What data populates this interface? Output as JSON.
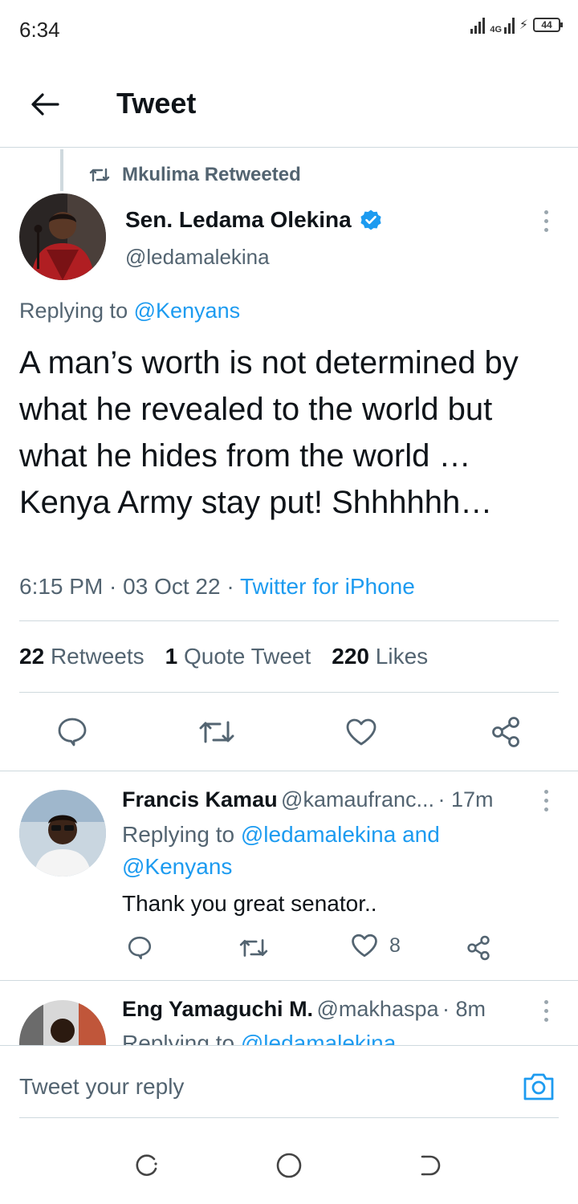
{
  "status_bar": {
    "time": "6:34",
    "network": "4G",
    "battery": "44"
  },
  "header": {
    "title": "Tweet"
  },
  "retweet_context": {
    "label": "Mkulima Retweeted"
  },
  "tweet": {
    "author_name": "Sen. Ledama Olekina",
    "author_handle": "@ledamalekina",
    "replying_prefix": "Replying to",
    "replying_to": "@Kenyans",
    "text": "A man’s worth is not determined by what he revealed to the world but what he hides from the world … Kenya Army stay put! Shhhhhh…",
    "time": "6:15 PM · 03 Oct 22 · ",
    "source": "Twitter for iPhone"
  },
  "stats": {
    "retweets_count": "22",
    "retweets_label": "Retweets",
    "quotes_count": "1",
    "quotes_label": "Quote Tweet",
    "likes_count": "220",
    "likes_label": "Likes"
  },
  "replies": [
    {
      "name": "Francis Kamau",
      "handle": "@kamaufranc...",
      "time": "· 17m",
      "replying_prefix": "Replying to",
      "replying_to_1": "@ledamalekina",
      "replying_and": "and",
      "replying_to_2": "@Kenyans",
      "text": "Thank you great senator..",
      "likes": "8"
    },
    {
      "name": "Eng Yamaguchi M.",
      "handle": "@makhaspa",
      "time": "· 8m",
      "replying_prefix": "Replying to",
      "replying_to_1": "@ledamalekina"
    }
  ],
  "reply_bar": {
    "placeholder": "Tweet your reply"
  },
  "colors": {
    "accent": "#1d9bf0",
    "muted": "#536471",
    "text": "#0f1419",
    "divider": "#cfd9de"
  }
}
